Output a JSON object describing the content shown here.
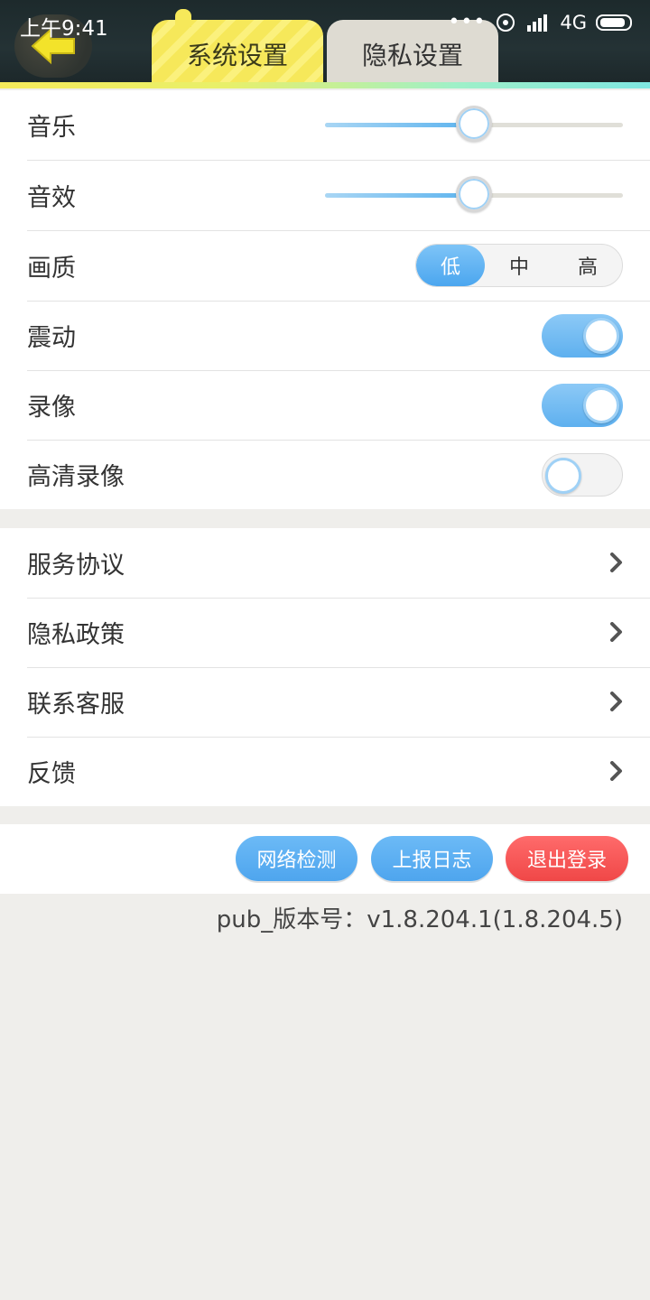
{
  "status_bar": {
    "time": "上午9:41",
    "dots": "•••",
    "network": "4G"
  },
  "tabs": [
    {
      "label": "系统设置",
      "active": true
    },
    {
      "label": "隐私设置",
      "active": false
    }
  ],
  "settings": {
    "music": {
      "label": "音乐",
      "value": 0.5
    },
    "sound_effect": {
      "label": "音效",
      "value": 0.5
    },
    "quality": {
      "label": "画质",
      "options": [
        "低",
        "中",
        "高"
      ],
      "selected": "低"
    },
    "vibration": {
      "label": "震动",
      "on": true
    },
    "recording": {
      "label": "录像",
      "on": true
    },
    "hd_recording": {
      "label": "高清录像",
      "on": false
    }
  },
  "links": [
    {
      "label": "服务协议"
    },
    {
      "label": "隐私政策"
    },
    {
      "label": "联系客服"
    },
    {
      "label": "反馈"
    }
  ],
  "buttons": {
    "network_test": "网络检测",
    "report_log": "上报日志",
    "logout": "退出登录"
  },
  "version": "pub_版本号：v1.8.204.1(1.8.204.5)",
  "colors": {
    "accent_blue": "#4ea5ee",
    "danger_red": "#f04747",
    "tab_yellow": "#f6e85a"
  }
}
